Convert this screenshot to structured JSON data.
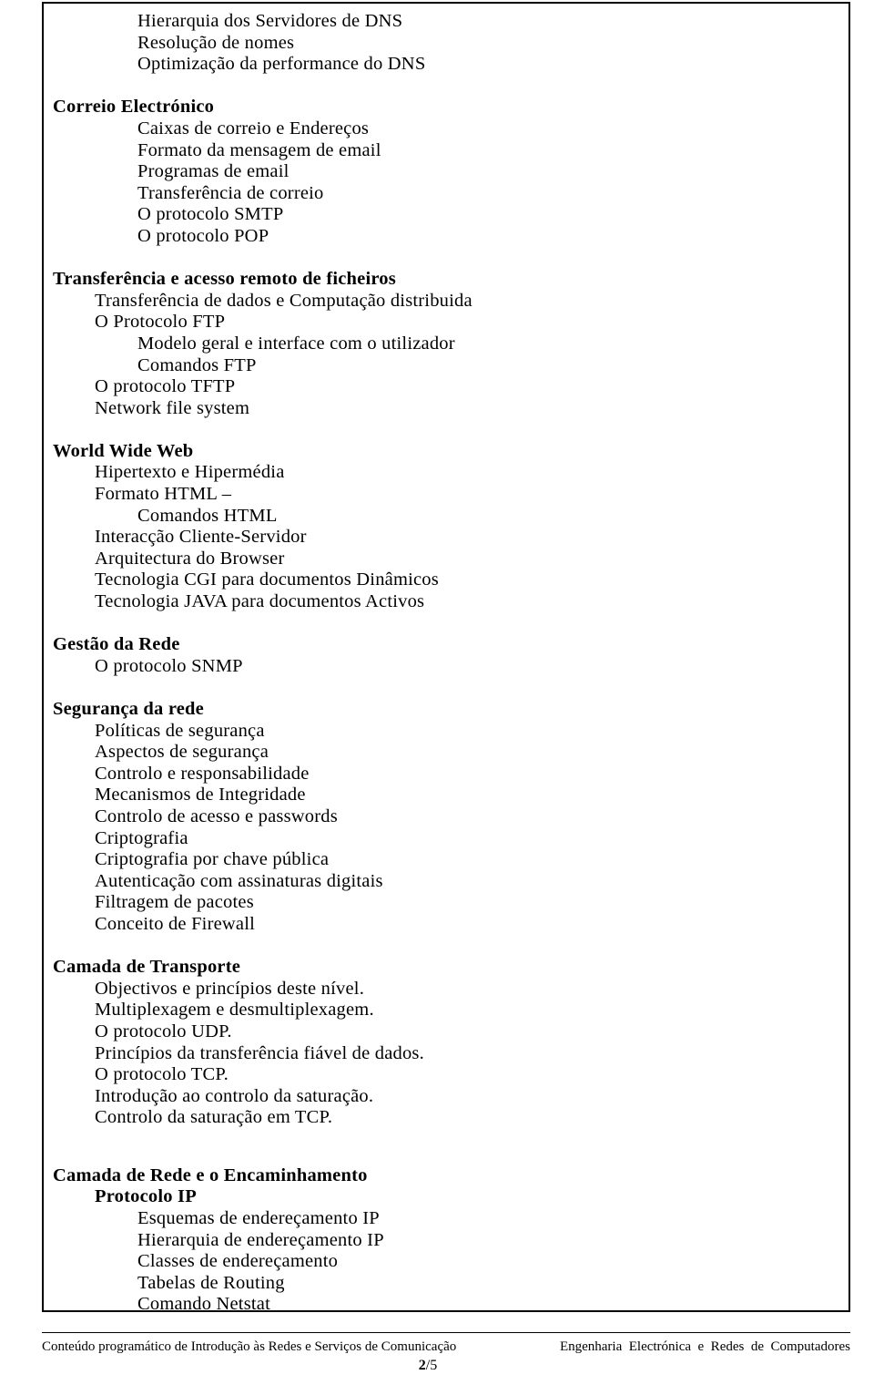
{
  "document": {
    "page_number": "2",
    "page_separator": "/",
    "page_total": "5",
    "footer_left": "Conteúdo programático de Introdução às Redes e Serviços de Comunicação",
    "footer_right": "Engenharia  Electrónica  e  Redes  de  Computadores"
  },
  "outline": [
    {
      "id": "l01",
      "text": "Hierarquia dos Servidores de DNS",
      "indent": 2,
      "bold": false
    },
    {
      "id": "l02",
      "text": "Resolução de nomes",
      "indent": 2,
      "bold": false
    },
    {
      "id": "l03",
      "text": "Optimização da performance do DNS",
      "indent": 2,
      "bold": false
    },
    {
      "id": "sp01",
      "text": "",
      "indent": 0,
      "bold": false,
      "spacer": true
    },
    {
      "id": "l04",
      "text": "Correio Electrónico",
      "indent": 0,
      "bold": true
    },
    {
      "id": "l05",
      "text": "Caixas de correio e Endereços",
      "indent": 2,
      "bold": false
    },
    {
      "id": "l06",
      "text": "Formato da mensagem de email",
      "indent": 2,
      "bold": false
    },
    {
      "id": "l07",
      "text": "Programas de email",
      "indent": 2,
      "bold": false
    },
    {
      "id": "l08",
      "text": "Transferência de correio",
      "indent": 2,
      "bold": false
    },
    {
      "id": "l09",
      "text": "O protocolo SMTP",
      "indent": 2,
      "bold": false
    },
    {
      "id": "l10",
      "text": "O protocolo POP",
      "indent": 2,
      "bold": false
    },
    {
      "id": "sp02",
      "text": "",
      "indent": 0,
      "bold": false,
      "spacer": true
    },
    {
      "id": "l11",
      "text": "Transferência e acesso remoto de ficheiros",
      "indent": 0,
      "bold": true
    },
    {
      "id": "l12",
      "text": "Transferência de dados e Computação distribuida",
      "indent": 1,
      "bold": false
    },
    {
      "id": "l13",
      "text": "O Protocolo FTP",
      "indent": 1,
      "bold": false
    },
    {
      "id": "l14",
      "text": "Modelo geral e interface com o utilizador",
      "indent": 2,
      "bold": false
    },
    {
      "id": "l15",
      "text": "Comandos FTP",
      "indent": 2,
      "bold": false
    },
    {
      "id": "l16",
      "text": "O protocolo TFTP",
      "indent": 1,
      "bold": false
    },
    {
      "id": "l17",
      "text": "Network file system",
      "indent": 1,
      "bold": false
    },
    {
      "id": "sp03",
      "text": "",
      "indent": 0,
      "bold": false,
      "spacer": true
    },
    {
      "id": "l18",
      "text": "World Wide Web",
      "indent": 0,
      "bold": true
    },
    {
      "id": "l19",
      "text": "Hipertexto e Hipermédia",
      "indent": 1,
      "bold": false
    },
    {
      "id": "l20",
      "text": "Formato HTML –",
      "indent": 1,
      "bold": false
    },
    {
      "id": "l21",
      "text": "Comandos HTML",
      "indent": 2,
      "bold": false
    },
    {
      "id": "l22",
      "text": "Interacção Cliente-Servidor",
      "indent": 1,
      "bold": false
    },
    {
      "id": "l23",
      "text": "Arquitectura do Browser",
      "indent": 1,
      "bold": false
    },
    {
      "id": "l24",
      "text": "Tecnologia CGI para documentos Dinâmicos",
      "indent": 1,
      "bold": false
    },
    {
      "id": "l25",
      "text": "Tecnologia JAVA para documentos Activos",
      "indent": 1,
      "bold": false
    },
    {
      "id": "sp04",
      "text": "",
      "indent": 0,
      "bold": false,
      "spacer": true
    },
    {
      "id": "l26",
      "text": "Gestão da Rede",
      "indent": 0,
      "bold": true
    },
    {
      "id": "l27",
      "text": "O protocolo SNMP",
      "indent": 1,
      "bold": false
    },
    {
      "id": "sp05",
      "text": "",
      "indent": 0,
      "bold": false,
      "spacer": true
    },
    {
      "id": "l28",
      "text": "Segurança da rede",
      "indent": 0,
      "bold": true
    },
    {
      "id": "l29",
      "text": "Políticas de segurança",
      "indent": 1,
      "bold": false
    },
    {
      "id": "l30",
      "text": "Aspectos de segurança",
      "indent": 1,
      "bold": false
    },
    {
      "id": "l31",
      "text": "Controlo e responsabilidade",
      "indent": 1,
      "bold": false
    },
    {
      "id": "l32",
      "text": "Mecanismos de Integridade",
      "indent": 1,
      "bold": false
    },
    {
      "id": "l33",
      "text": "Controlo de acesso e passwords",
      "indent": 1,
      "bold": false
    },
    {
      "id": "l34",
      "text": "Criptografia",
      "indent": 1,
      "bold": false
    },
    {
      "id": "l35",
      "text": "Criptografia por chave pública",
      "indent": 1,
      "bold": false
    },
    {
      "id": "l36",
      "text": "Autenticação com assinaturas digitais",
      "indent": 1,
      "bold": false
    },
    {
      "id": "l37",
      "text": "Filtragem de pacotes",
      "indent": 1,
      "bold": false
    },
    {
      "id": "l38",
      "text": "Conceito de Firewall",
      "indent": 1,
      "bold": false
    },
    {
      "id": "sp06",
      "text": "",
      "indent": 0,
      "bold": false,
      "spacer": true
    },
    {
      "id": "l39",
      "text": "Camada de Transporte",
      "indent": 0,
      "bold": true
    },
    {
      "id": "l40",
      "text": "Objectivos e princípios deste nível.",
      "indent": 1,
      "bold": false
    },
    {
      "id": "l41",
      "text": "Multiplexagem e desmultiplexagem.",
      "indent": 1,
      "bold": false
    },
    {
      "id": "l42",
      "text": "O protocolo UDP.",
      "indent": 1,
      "bold": false
    },
    {
      "id": "l43",
      "text": "Princípios da transferência fiável de dados.",
      "indent": 1,
      "bold": false
    },
    {
      "id": "l44",
      "text": "O protocolo TCP.",
      "indent": 1,
      "bold": false
    },
    {
      "id": "l45",
      "text": "Introdução ao controlo da saturação.",
      "indent": 1,
      "bold": false
    },
    {
      "id": "l46",
      "text": "Controlo da saturação em TCP.",
      "indent": 1,
      "bold": false
    },
    {
      "id": "sp07",
      "text": "",
      "indent": 0,
      "bold": false,
      "spacer": "large"
    },
    {
      "id": "l47",
      "text": "Camada de Rede e o Encaminhamento",
      "indent": 0,
      "bold": true
    },
    {
      "id": "l48",
      "text": "Protocolo IP",
      "indent": 1,
      "bold": true
    },
    {
      "id": "l49",
      "text": "Esquemas de endereçamento IP",
      "indent": 2,
      "bold": false
    },
    {
      "id": "l50",
      "text": "Hierarquia de endereçamento IP",
      "indent": 2,
      "bold": false
    },
    {
      "id": "l51",
      "text": "Classes de endereçamento",
      "indent": 2,
      "bold": false
    },
    {
      "id": "l52",
      "text": "Tabelas de Routing",
      "indent": 2,
      "bold": false
    },
    {
      "id": "l53",
      "text": "Comando Netstat",
      "indent": 2,
      "bold": false
    }
  ]
}
